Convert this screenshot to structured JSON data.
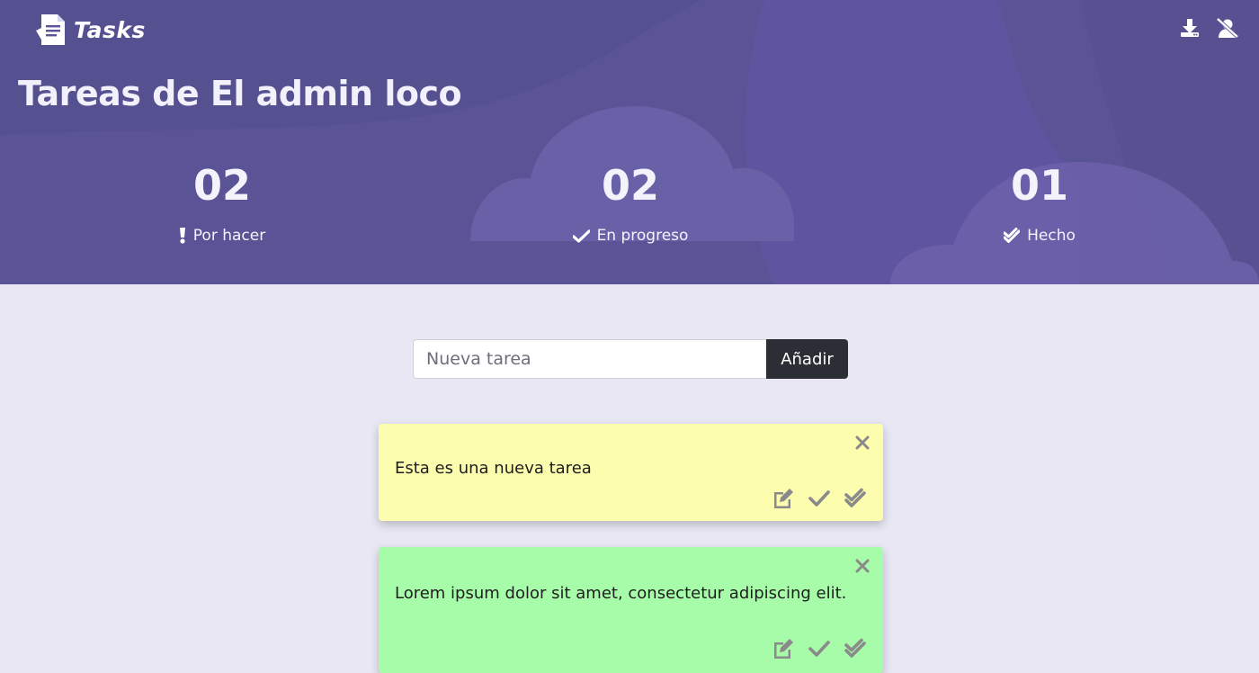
{
  "app": {
    "brand": "Tasks",
    "page_title": "Tareas de El admin loco"
  },
  "header_actions": [
    {
      "name": "download-icon"
    },
    {
      "name": "user-slash-icon"
    }
  ],
  "stats": [
    {
      "count": "02",
      "label": "Por hacer",
      "icon": "exclamation-icon"
    },
    {
      "count": "02",
      "label": "En progreso",
      "icon": "check-icon"
    },
    {
      "count": "01",
      "label": "Hecho",
      "icon": "double-check-icon"
    }
  ],
  "add_task": {
    "placeholder": "Nueva tarea",
    "button_label": "Añadir"
  },
  "tasks": [
    {
      "text": "Esta es una nueva tarea",
      "color": "#fdfdb0",
      "status": "Por hacer"
    },
    {
      "text": "Lorem ipsum dolor sit amet, consectetur adipiscing elit.",
      "color": "#a7fca9",
      "status": "Hecho"
    }
  ],
  "colors": {
    "hero": "#5a5497",
    "background": "#e8e7f3",
    "button_dark": "#2b2f35",
    "icon_gray": "#8a8a8a"
  }
}
